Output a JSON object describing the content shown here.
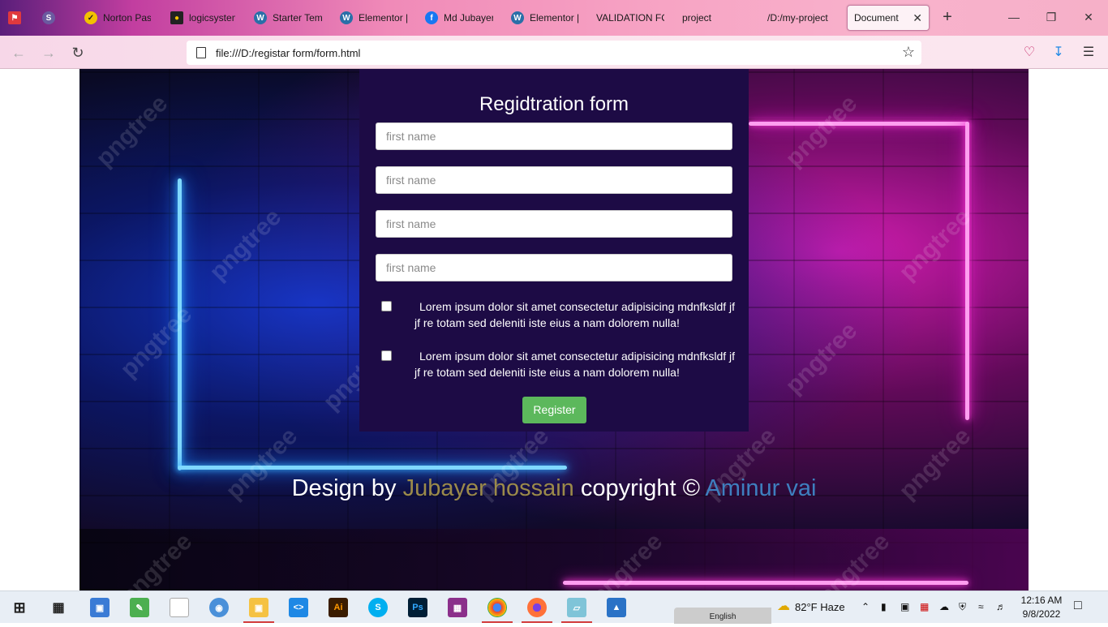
{
  "browser": {
    "tabs": [
      {
        "title": "Norton Pass",
        "icon": "norton-icon"
      },
      {
        "title": "logicsystem",
        "icon": "logic-icon"
      },
      {
        "title": "Starter Temp",
        "icon": "wordpress-icon"
      },
      {
        "title": "Elementor |",
        "icon": "wordpress-icon"
      },
      {
        "title": "Md Jubayer",
        "icon": "facebook-icon"
      },
      {
        "title": "Elementor |",
        "icon": "wordpress-icon"
      },
      {
        "title": "VALIDATION FO",
        "icon": "blank-icon"
      },
      {
        "title": "project",
        "icon": "blank-icon"
      },
      {
        "title": "/D:/my-project",
        "icon": "blank-icon"
      },
      {
        "title": "Document",
        "icon": "blank-icon",
        "active": true
      }
    ],
    "url": "file:///D:/registar form/form.html"
  },
  "form": {
    "title": "Regidtration form",
    "fields": [
      {
        "placeholder": "first name"
      },
      {
        "placeholder": "first name"
      },
      {
        "placeholder": "first name"
      },
      {
        "placeholder": "first name"
      }
    ],
    "checkboxes": [
      {
        "label": "Lorem ipsum dolor sit amet consectetur adipisicing mdnfksldf jf jf re totam sed deleniti iste eius a nam dolorem nulla!",
        "checked": false
      },
      {
        "label": "Lorem ipsum dolor sit amet consectetur adipisicing mdnfksldf jf jf re totam sed deleniti iste eius a nam dolorem nulla!",
        "checked": false
      }
    ],
    "submit_label": "Register"
  },
  "footer": {
    "prefix": "Design by",
    "author": "Jubayer hossain",
    "middle": "copyright ©",
    "credit": "Aminur vai"
  },
  "watermark": "pngtree",
  "taskbar": {
    "weather": "82°F  Haze",
    "language": "English",
    "time": "12:16 AM",
    "date": "9/8/2022"
  },
  "colors": {
    "form_bg": "#1d0b45",
    "button": "#5cb85c",
    "author": "#9b8a4a",
    "credit": "#3e7fbf",
    "neon_blue": "#7fd8ff",
    "neon_pink": "#ff9ef0"
  }
}
